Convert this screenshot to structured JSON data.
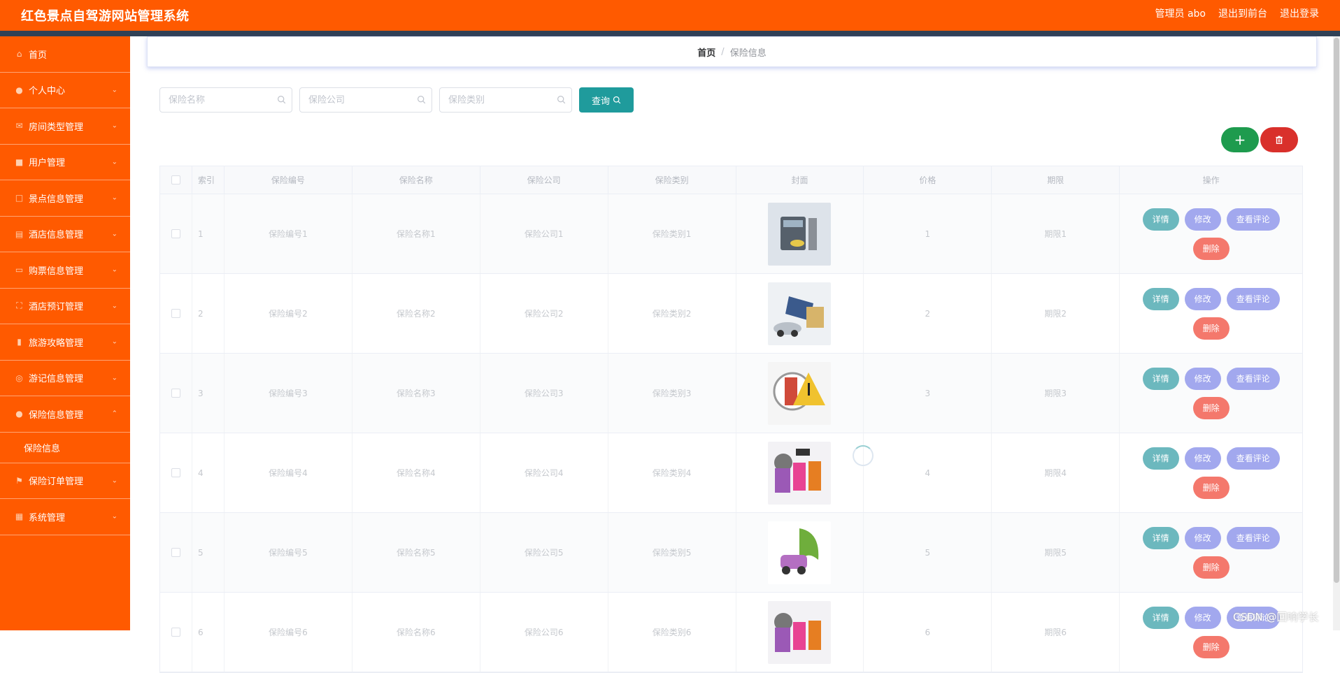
{
  "app": {
    "title": "红色景点自驾游网站管理系统"
  },
  "header": {
    "user_label": "管理员 abo",
    "front_link": "退出到前台",
    "logout_link": "退出登录"
  },
  "sidebar": {
    "items": [
      {
        "label": "首页",
        "icon": "home-icon"
      },
      {
        "label": "个人中心",
        "icon": "person-icon"
      },
      {
        "label": "房间类型管理",
        "icon": "mail-icon"
      },
      {
        "label": "用户管理",
        "icon": "user-manage-icon"
      },
      {
        "label": "景点信息管理",
        "icon": "crop-icon"
      },
      {
        "label": "酒店信息管理",
        "icon": "hotel-icon"
      },
      {
        "label": "购票信息管理",
        "icon": "chat-icon"
      },
      {
        "label": "酒店预订管理",
        "icon": "frame-icon"
      },
      {
        "label": "旅游攻略管理",
        "icon": "bar-chart-icon"
      },
      {
        "label": "游记信息管理",
        "icon": "globe-icon"
      },
      {
        "label": "保险信息管理",
        "icon": "person-icon"
      },
      {
        "label": "保险订单管理",
        "icon": "flag-icon"
      },
      {
        "label": "系统管理",
        "icon": "grid-icon"
      }
    ],
    "sub_item": "保险信息"
  },
  "breadcrumb": {
    "home": "首页",
    "sep": "/",
    "current": "保险信息"
  },
  "search": {
    "name_placeholder": "保险名称",
    "company_placeholder": "保险公司",
    "category_placeholder": "保险类别",
    "query_label": "查询"
  },
  "table": {
    "headers": [
      "索引",
      "保险编号",
      "保险名称",
      "保险公司",
      "保险类别",
      "封面",
      "价格",
      "期限",
      "操作"
    ],
    "actions": {
      "detail": "详情",
      "edit": "修改",
      "comment": "查看评论",
      "remove": "删除"
    },
    "rows": [
      {
        "index": "1",
        "code": "保险编号1",
        "name": "保险名称1",
        "company": "保险公司1",
        "category": "保险类别1",
        "price": "1",
        "term": "期限1"
      },
      {
        "index": "2",
        "code": "保险编号2",
        "name": "保险名称2",
        "company": "保险公司2",
        "category": "保险类别2",
        "price": "2",
        "term": "期限2"
      },
      {
        "index": "3",
        "code": "保险编号3",
        "name": "保险名称3",
        "company": "保险公司3",
        "category": "保险类别3",
        "price": "3",
        "term": "期限3"
      },
      {
        "index": "4",
        "code": "保险编号4",
        "name": "保险名称4",
        "company": "保险公司4",
        "category": "保险类别4",
        "price": "4",
        "term": "期限4"
      },
      {
        "index": "5",
        "code": "保险编号5",
        "name": "保险名称5",
        "company": "保险公司5",
        "category": "保险类别5",
        "price": "5",
        "term": "期限5"
      },
      {
        "index": "6",
        "code": "保险编号6",
        "name": "保险名称6",
        "company": "保险公司6",
        "category": "保险类别6",
        "price": "6",
        "term": "期限6"
      }
    ]
  },
  "watermark": "CSDN @回响学长",
  "colors": {
    "brand": "#ff5a00",
    "nav_dark": "#304156",
    "query": "#1f9b9c",
    "add": "#1e9b4e",
    "delete": "#d9302b"
  }
}
